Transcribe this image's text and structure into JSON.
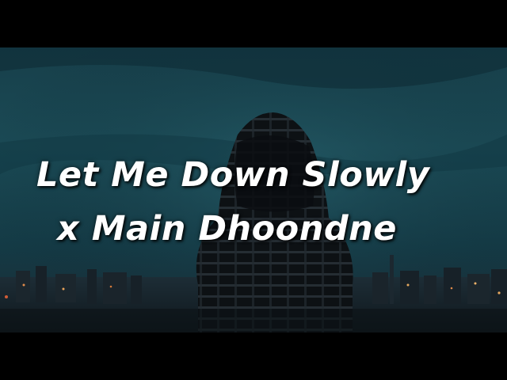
{
  "video": {
    "title_line_1": "Let Me Down Slowly",
    "title_line_2": "x Main Dhoondne"
  },
  "colors": {
    "sky_top": "#1c4a55",
    "sky_mid": "#0f3a45",
    "horizon": "#1e3b46",
    "city": "#141e24",
    "figure": "#0d1114",
    "text": "#ffffff"
  }
}
